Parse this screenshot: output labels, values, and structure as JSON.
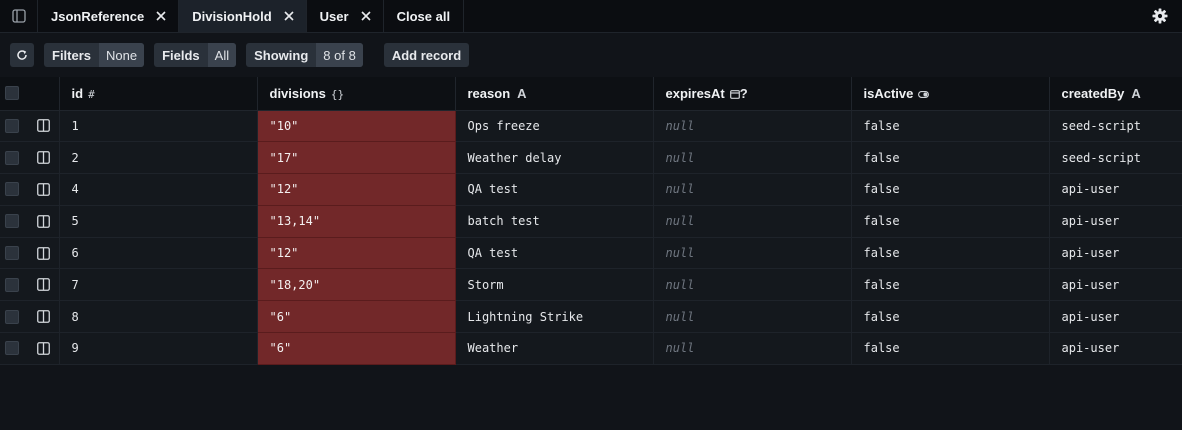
{
  "tabs": [
    {
      "label": "JsonReference",
      "active": false
    },
    {
      "label": "DivisionHold",
      "active": true
    },
    {
      "label": "User",
      "active": false
    }
  ],
  "close_all_label": "Close all",
  "toolbar": {
    "filters_label": "Filters",
    "filters_value": "None",
    "fields_label": "Fields",
    "fields_value": "All",
    "showing_label": "Showing",
    "showing_value": "8 of 8",
    "add_record_label": "Add record"
  },
  "columns": [
    {
      "name": "id",
      "type_icon": "#"
    },
    {
      "name": "divisions",
      "type_icon": "{}"
    },
    {
      "name": "reason",
      "type_icon": "A"
    },
    {
      "name": "expiresAt",
      "type_icon": "calendar-optional"
    },
    {
      "name": "isActive",
      "type_icon": "toggle"
    },
    {
      "name": "createdBy",
      "type_icon": "A"
    }
  ],
  "rows": [
    {
      "id": "1",
      "divisions": "\"10\"",
      "reason": "Ops freeze",
      "expiresAt": "null",
      "isActive": "false",
      "createdBy": "seed-script"
    },
    {
      "id": "2",
      "divisions": "\"17\"",
      "reason": "Weather delay",
      "expiresAt": "null",
      "isActive": "false",
      "createdBy": "seed-script"
    },
    {
      "id": "4",
      "divisions": "\"12\"",
      "reason": "QA test",
      "expiresAt": "null",
      "isActive": "false",
      "createdBy": "api-user"
    },
    {
      "id": "5",
      "divisions": "\"13,14\"",
      "reason": "batch test",
      "expiresAt": "null",
      "isActive": "false",
      "createdBy": "api-user"
    },
    {
      "id": "6",
      "divisions": "\"12\"",
      "reason": "QA test",
      "expiresAt": "null",
      "isActive": "false",
      "createdBy": "api-user"
    },
    {
      "id": "7",
      "divisions": "\"18,20\"",
      "reason": "Storm",
      "expiresAt": "null",
      "isActive": "false",
      "createdBy": "api-user"
    },
    {
      "id": "8",
      "divisions": "\"6\"",
      "reason": "Lightning Strike",
      "expiresAt": "null",
      "isActive": "false",
      "createdBy": "api-user"
    },
    {
      "id": "9",
      "divisions": "\"6\"",
      "reason": "Weather",
      "expiresAt": "null",
      "isActive": "false",
      "createdBy": "api-user"
    }
  ],
  "colors": {
    "background": "#111419",
    "error_cell": "#722829",
    "active_tab": "#1c222a"
  }
}
